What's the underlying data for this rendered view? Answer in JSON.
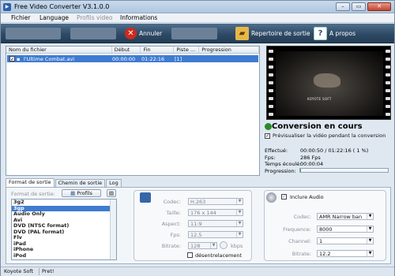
{
  "window": {
    "title": "Free Video Converter V3.1.0.0"
  },
  "menu": {
    "items": [
      {
        "label": "Fichier",
        "enabled": true
      },
      {
        "label": "Language",
        "enabled": true
      },
      {
        "label": "Profils video",
        "enabled": false
      },
      {
        "label": "Informations",
        "enabled": true
      }
    ]
  },
  "toolbar": {
    "cancel_label": "Annuler",
    "output_dir_label": "Repertoire de sortie",
    "about_label": "A propos",
    "about_icon_text": "?"
  },
  "filelist": {
    "columns": [
      "Nom du fichier",
      "Début",
      "Fin",
      "Piste ...",
      "Progression"
    ],
    "rows": [
      {
        "name": "l'Ultime Combat.avi",
        "start": "00:00:00",
        "end": "01:22:16",
        "track": "[1]",
        "progress": ""
      }
    ]
  },
  "preview": {
    "caption": "KOYOTE SOFT",
    "checkbox_label": "Prévisualiser la vidéo pendant la conversion",
    "checked": true
  },
  "conversion": {
    "title": "Conversion en cours",
    "effectue_label": "Effectué:",
    "effectue_value": "00:00:50 / 01:22:16  ( 1 %)",
    "fps_label": "Fps:",
    "fps_value": "286 Fps",
    "elapsed_label": "Temps écoulé:",
    "elapsed_value": "00:00:04",
    "progress_label": "Progression:",
    "progress_fraction": 0.01
  },
  "tabs": [
    "Format de sortie",
    "Chemin de sortie",
    "Log"
  ],
  "format_panel": {
    "format_label": "Format de sortie:",
    "profils_button": "Profils",
    "formats": [
      "3g2",
      "3gp",
      "Audio Only",
      "Avi",
      "DVD (NTSC format)",
      "DVD (PAL format)",
      "Flv",
      "iPad",
      "iPhone",
      "iPod"
    ],
    "selected_index": 1
  },
  "video": {
    "codec_label": "Codec:",
    "codec_value": "H.263",
    "size_label": "Taille:",
    "size_value": "176 x 144",
    "aspect_label": "Aspect:",
    "aspect_value": "11:9",
    "fps_label": "Fps:",
    "fps_value": "12.5",
    "bitrate_label": "Bitrate:",
    "bitrate_value": "128",
    "bitrate_unit": "kbps",
    "deinterlace_label": "désentrelacement"
  },
  "audio": {
    "include_label": "Inclure Audio",
    "codec_label": "Codec:",
    "codec_value": "AMR Narrow ban",
    "freq_label": "Frequence:",
    "freq_value": "8000",
    "channel_label": "Channel:",
    "channel_value": "1",
    "bitrate_label": "Bitrate:",
    "bitrate_value": "12.2"
  },
  "statusbar": {
    "company": "Koyote Soft",
    "status": "Pret!"
  }
}
